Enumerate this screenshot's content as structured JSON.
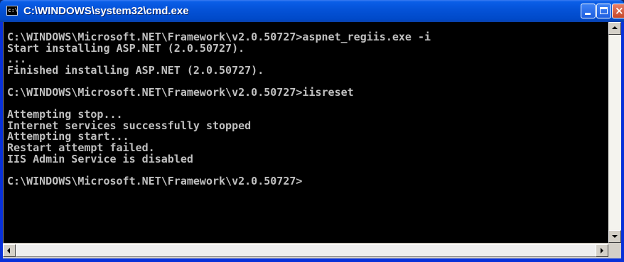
{
  "window": {
    "title": "C:\\WINDOWS\\system32\\cmd.exe",
    "icon_text": "c:\\",
    "buttons": {
      "minimize": "minimize",
      "maximize": "maximize",
      "close": "×"
    }
  },
  "console": {
    "lines": [
      "",
      "C:\\WINDOWS\\Microsoft.NET\\Framework\\v2.0.50727>aspnet_regiis.exe -i",
      "Start installing ASP.NET (2.0.50727).",
      "...",
      "Finished installing ASP.NET (2.0.50727).",
      "",
      "C:\\WINDOWS\\Microsoft.NET\\Framework\\v2.0.50727>iisreset",
      "",
      "Attempting stop...",
      "Internet services successfully stopped",
      "Attempting start...",
      "Restart attempt failed.",
      "IIS Admin Service is disabled",
      "",
      "C:\\WINDOWS\\Microsoft.NET\\Framework\\v2.0.50727>"
    ]
  },
  "colors": {
    "titlebar": "#0553d9",
    "console_background": "#000000",
    "console_text": "#c0c0c0",
    "close_button": "#c64628"
  }
}
